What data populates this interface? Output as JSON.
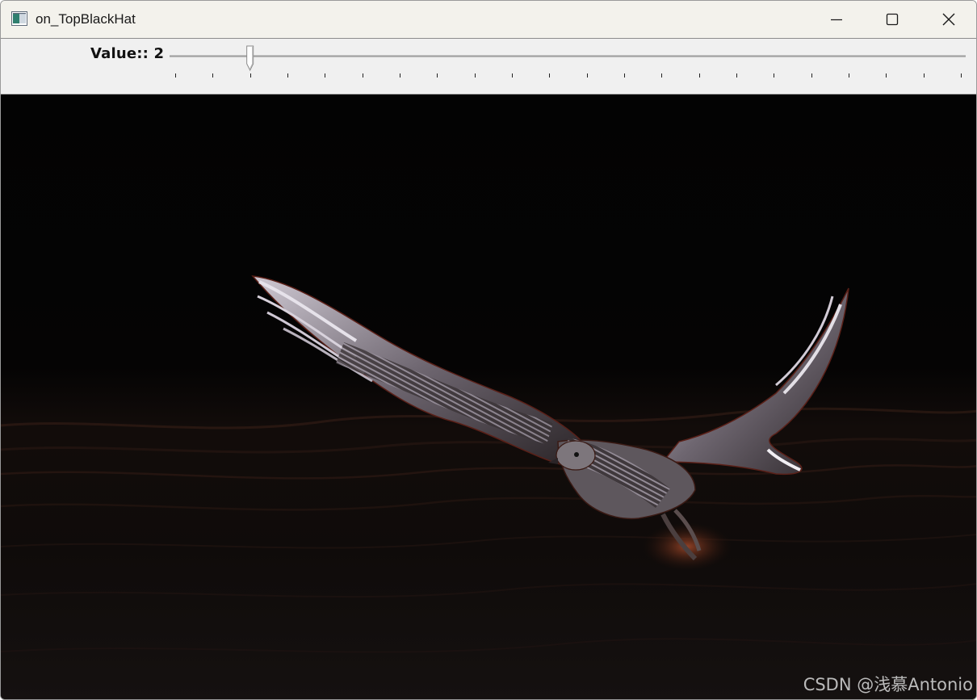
{
  "window": {
    "title": "on_TopBlackHat",
    "controls": {
      "minimize_icon": "minimize-icon",
      "maximize_icon": "maximize-icon",
      "close_icon": "close-icon"
    }
  },
  "trackbar": {
    "label": "Value:: 2",
    "value": 2
  },
  "image": {
    "subject": "hawk-in-flight-over-water",
    "watermark": "CSDN @浅慕Antonio"
  },
  "colors": {
    "titlebar_bg": "#f3f2ec",
    "panel_bg": "#f0f0f0",
    "image_bg": "#030303"
  }
}
